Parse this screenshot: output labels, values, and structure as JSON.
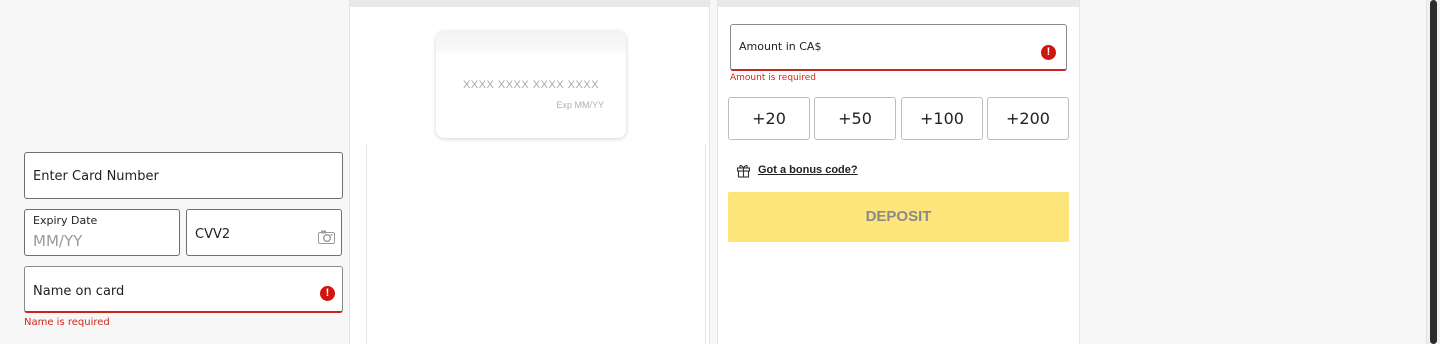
{
  "card_preview": {
    "number_placeholder": "XXXX XXXX XXXX XXXX",
    "expiry_placeholder": "Exp MM/YY"
  },
  "card_form": {
    "card_number_label": "Enter Card Number",
    "expiry_label": "Expiry Date",
    "expiry_placeholder": "MM/YY",
    "cvv_label": "CVV2",
    "name_label": "Name on card",
    "name_error": "Name is required",
    "error_icon": "!"
  },
  "deposit": {
    "amount_label": "Amount in CA$",
    "amount_error": "Amount is required",
    "quick_amounts": [
      "+20",
      "+50",
      "+100",
      "+200"
    ],
    "bonus_link": "Got a bonus code?",
    "button_label": "DEPOSIT"
  },
  "colors": {
    "error": "#d2271b",
    "deposit_button": "#fde57c"
  },
  "icons": {
    "gift": "gift-icon",
    "camera": "camera-icon",
    "error": "error-icon"
  }
}
